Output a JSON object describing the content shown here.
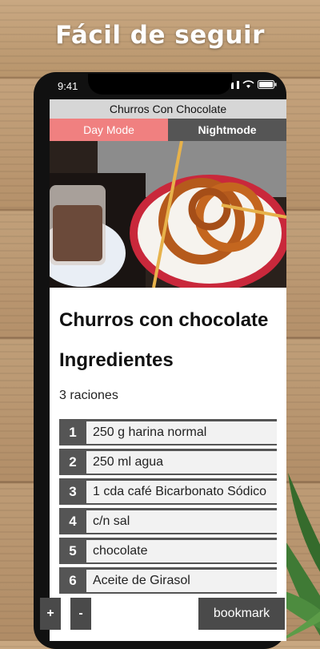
{
  "promo": {
    "title": "Fácil de seguir"
  },
  "status": {
    "time": "9:41"
  },
  "app": {
    "title": "Churros Con Chocolate",
    "day_mode_label": "Day Mode",
    "night_mode_label": "Nightmode"
  },
  "recipe": {
    "title": "Churros con chocolate",
    "ingredients_heading": "Ingredientes",
    "servings": "3 raciones",
    "ingredients": [
      {
        "num": "1",
        "text": "250 g harina normal"
      },
      {
        "num": "2",
        "text": "250 ml agua"
      },
      {
        "num": "3",
        "text": "1 cda café Bicarbonato Sódico"
      },
      {
        "num": "4",
        "text": "c/n sal"
      },
      {
        "num": "5",
        "text": "chocolate"
      },
      {
        "num": "6",
        "text": "Aceite de Girasol"
      }
    ]
  },
  "controls": {
    "zoom_in_label": "+",
    "zoom_out_label": "-",
    "bookmark_label": "bookmark"
  },
  "colors": {
    "day_mode_bg": "#f08080",
    "night_mode_bg": "#555555",
    "number_badge_bg": "#555555"
  }
}
